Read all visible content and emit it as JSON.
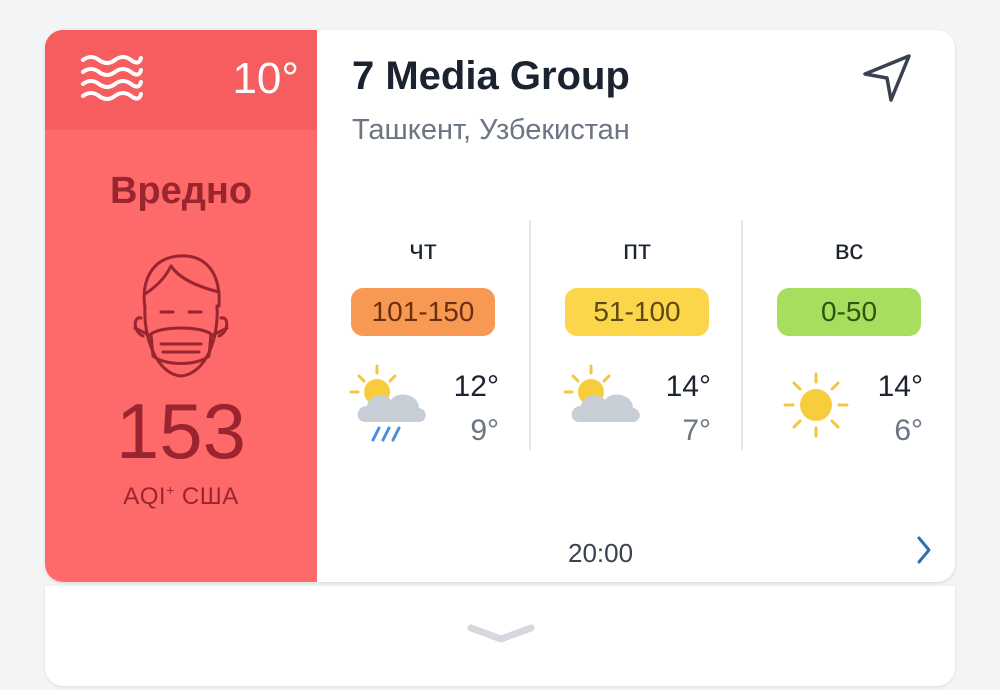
{
  "aqi": {
    "current_temp": "10°",
    "status": "Вредно",
    "value": "153",
    "unit_prefix": "AQI",
    "unit_sup": "+",
    "unit_suffix": " США",
    "colors": {
      "panel": "#fe6a69",
      "header": "#f55d5e",
      "text": "#9a2530"
    },
    "icons": {
      "wind": "wind-waves-icon",
      "face": "face-mask-icon"
    }
  },
  "station": {
    "name": "7 Media Group",
    "location": "Ташкент, Узбекистан",
    "nav_icon": "location-arrow-icon"
  },
  "forecast": [
    {
      "day": "чт",
      "aqi_range": "101-150",
      "aqi_color": "#f89953",
      "weather": "sun-cloud-rain-icon",
      "high": "12°",
      "low": "9°"
    },
    {
      "day": "пт",
      "aqi_range": "51-100",
      "aqi_color": "#fbd64a",
      "weather": "sun-cloud-icon",
      "high": "14°",
      "low": "7°"
    },
    {
      "day": "вс",
      "aqi_range": "0-50",
      "aqi_color": "#a7de5e",
      "weather": "sun-icon",
      "high": "14°",
      "low": "6°"
    }
  ],
  "footer": {
    "time": "20:00",
    "more_icon": "chevron-right-icon",
    "expand_icon": "chevron-down-icon"
  }
}
